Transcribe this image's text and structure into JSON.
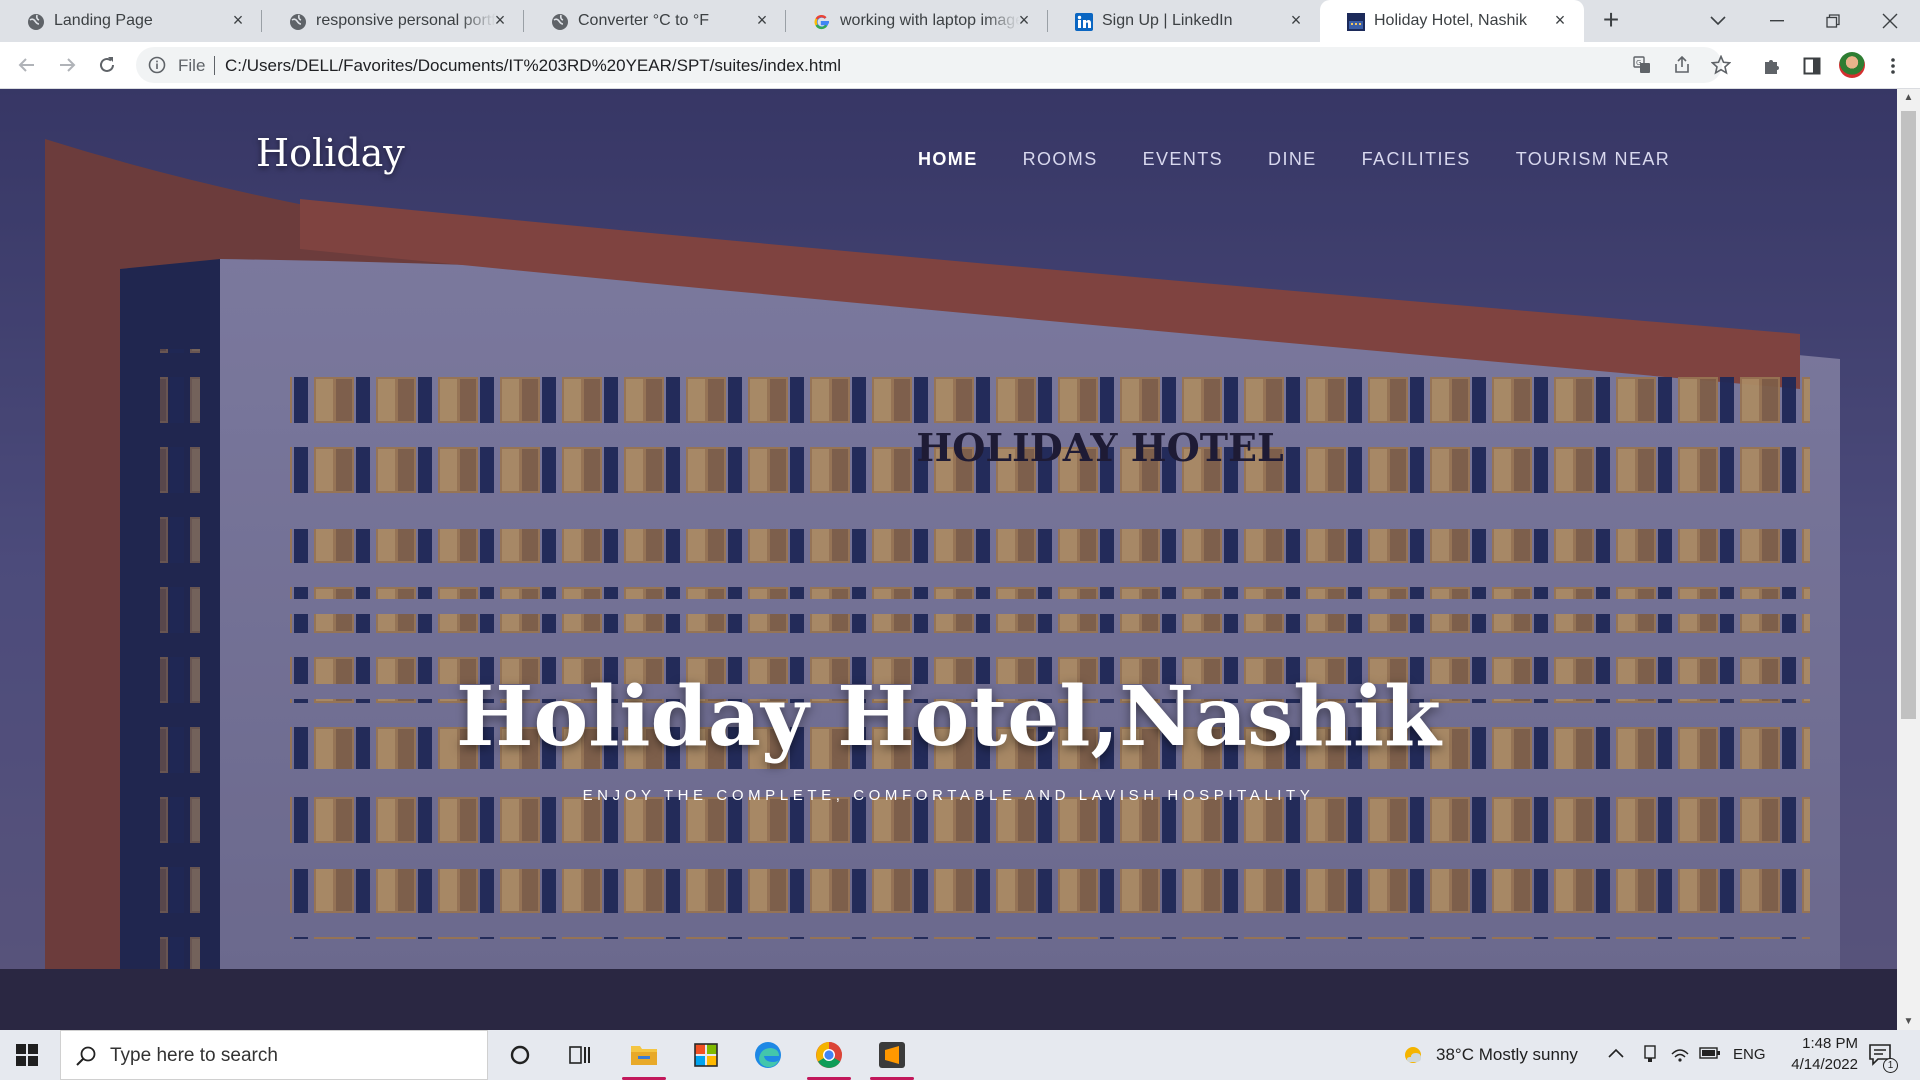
{
  "browser": {
    "tabs": [
      {
        "title": "Landing Page",
        "favicon": "globe-icon",
        "active": false
      },
      {
        "title": "responsive personal portfolio",
        "favicon": "globe-icon",
        "active": false
      },
      {
        "title": "Converter °C to °F",
        "favicon": "globe-icon",
        "active": false
      },
      {
        "title": "working with laptop images",
        "favicon": "google-icon",
        "active": false
      },
      {
        "title": "Sign Up | LinkedIn",
        "favicon": "linkedin-icon",
        "active": false
      },
      {
        "title": "Holiday Hotel, Nashik",
        "favicon": "site-icon",
        "active": true
      }
    ],
    "close_glyph": "×",
    "new_tab_glyph": "+",
    "address": {
      "scheme_label": "File",
      "url": "C:/Users/DELL/Favorites/Documents/IT%203RD%20YEAR/SPT/suites/index.html"
    }
  },
  "site": {
    "logo": "Holiday",
    "nav": [
      {
        "label": "HOME",
        "active": true
      },
      {
        "label": "ROOMS",
        "active": false
      },
      {
        "label": "EVENTS",
        "active": false
      },
      {
        "label": "DINE",
        "active": false
      },
      {
        "label": "FACILITIES",
        "active": false
      },
      {
        "label": "TOURISM NEAR",
        "active": false
      }
    ],
    "building_sign": "HOLIDAY HOTEL",
    "hero_title": "Holiday Hotel,Nashik",
    "hero_subtitle": "ENJOY THE COMPLETE, COMFORTABLE AND LAVISH HOSPITALITY"
  },
  "taskbar": {
    "search_placeholder": "Type here to search",
    "weather": "38°C  Mostly sunny",
    "language": "ENG",
    "time": "1:48 PM",
    "date": "4/14/2022",
    "notification_count": "1"
  },
  "colors": {
    "tabstrip": "#dee1e6",
    "hero_overlay": "#2f2850",
    "nav_active": "#ffffff",
    "task_underline": "#c2185b"
  }
}
